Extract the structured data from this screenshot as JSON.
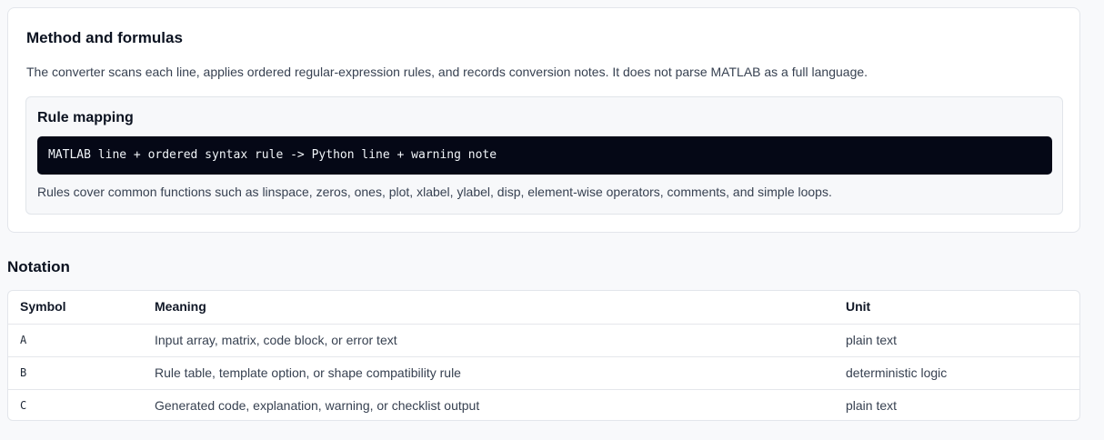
{
  "method": {
    "title": "Method and formulas",
    "description": "The converter scans each line, applies ordered regular-expression rules, and records conversion notes. It does not parse MATLAB as a full language.",
    "rule_mapping": {
      "title": "Rule mapping",
      "code": "MATLAB line + ordered syntax rule -> Python line + warning note",
      "note": "Rules cover common functions such as linspace, zeros, ones, plot, xlabel, ylabel, disp, element-wise operators, comments, and simple loops."
    }
  },
  "notation": {
    "title": "Notation",
    "headers": {
      "symbol": "Symbol",
      "meaning": "Meaning",
      "unit": "Unit"
    },
    "rows": [
      {
        "symbol": "A",
        "meaning": "Input array, matrix, code block, or error text",
        "unit": "plain text"
      },
      {
        "symbol": "B",
        "meaning": "Rule table, template option, or shape compatibility rule",
        "unit": "deterministic logic"
      },
      {
        "symbol": "C",
        "meaning": "Generated code, explanation, warning, or checklist output",
        "unit": "plain text"
      }
    ]
  }
}
